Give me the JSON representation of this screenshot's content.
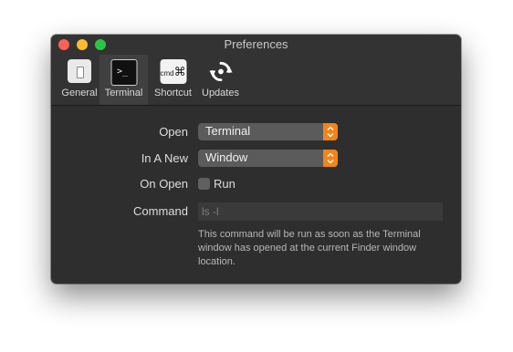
{
  "window": {
    "title": "Preferences"
  },
  "tabs": [
    {
      "label": "General",
      "icon": "general-icon"
    },
    {
      "label": "Terminal",
      "icon": "terminal-icon",
      "glyph": ">_",
      "active": true
    },
    {
      "label": "Shortcut",
      "icon": "shortcut-icon",
      "glyph_text": "cmd",
      "glyph_symbol": "⌘"
    },
    {
      "label": "Updates",
      "icon": "updates-icon"
    }
  ],
  "form": {
    "open": {
      "label": "Open",
      "value": "Terminal"
    },
    "in_a_new": {
      "label": "In A New",
      "value": "Window"
    },
    "on_open": {
      "label": "On Open",
      "checkbox_label": "Run",
      "checked": false
    },
    "command": {
      "label": "Command",
      "placeholder": "ls -l",
      "help": "This command will be run as soon as the Terminal window has opened at the current Finder window location."
    }
  },
  "colors": {
    "accent": "#f1841a",
    "window_bg": "#2e2e2e",
    "toolbar_bg": "#333333"
  }
}
